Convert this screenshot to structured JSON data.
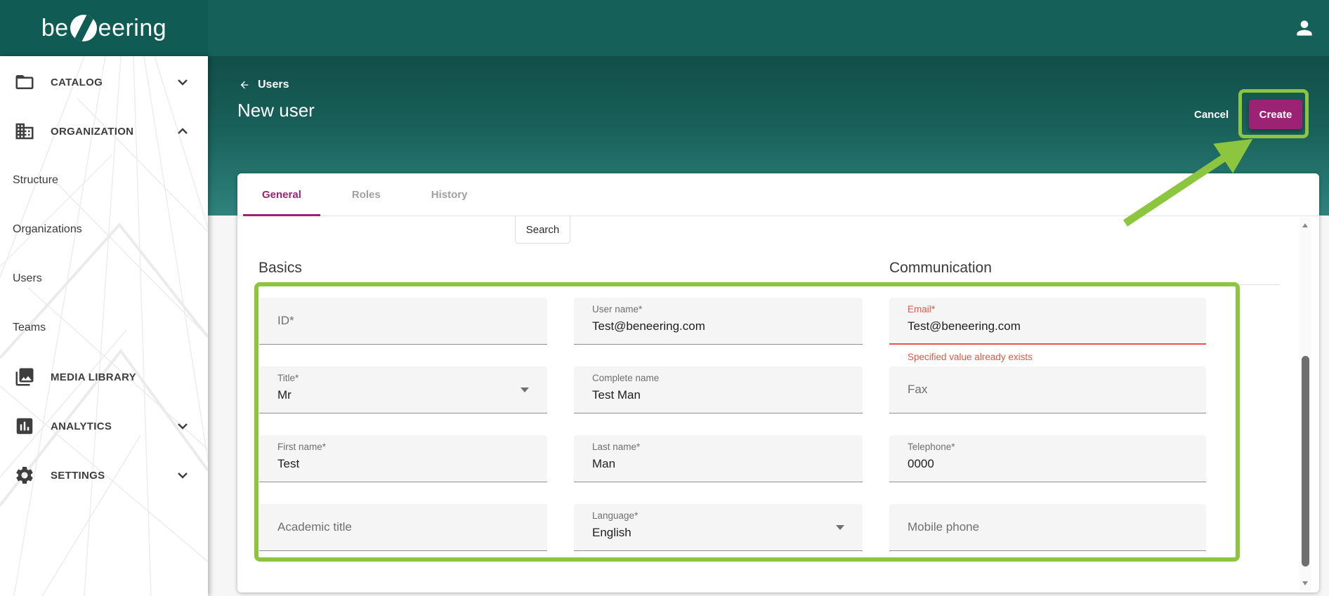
{
  "colors": {
    "topbar_teal": "#156058",
    "logo_block_teal": "#115B55",
    "header_gradient_top": "#114E49",
    "header_gradient_bottom": "#2F837D",
    "accent_magenta": "#9C2373",
    "annotation_green": "#8CC63E",
    "error_red": "#E8544A"
  },
  "brand": {
    "prefix": "be",
    "suffix": "eering"
  },
  "sidebar": {
    "items": [
      {
        "label": "CATALOG",
        "icon": "folder-icon",
        "chevron": "down"
      },
      {
        "label": "ORGANIZATION",
        "icon": "building-icon",
        "chevron": "up",
        "children": [
          {
            "label": "Structure"
          },
          {
            "label": "Organizations"
          },
          {
            "label": "Users"
          },
          {
            "label": "Teams"
          }
        ]
      },
      {
        "label": "MEDIA LIBRARY",
        "icon": "media-library-icon",
        "chevron": ""
      },
      {
        "label": "ANALYTICS",
        "icon": "analytics-icon",
        "chevron": "down"
      },
      {
        "label": "SETTINGS",
        "icon": "gear-icon",
        "chevron": "down"
      }
    ]
  },
  "header": {
    "back": "Users",
    "title": "New user",
    "cancel": "Cancel",
    "create": "Create"
  },
  "tabs": [
    {
      "label": "General",
      "active": true
    },
    {
      "label": "Roles",
      "active": false
    },
    {
      "label": "History",
      "active": false
    }
  ],
  "toolbar": {
    "search": "Search"
  },
  "form": {
    "basics_title": "Basics",
    "communication_title": "Communication",
    "id": {
      "placeholder": "ID*"
    },
    "user_name": {
      "label": "User name*",
      "value": "Test@beneering.com"
    },
    "email": {
      "label": "Email*",
      "value": "Test@beneering.com",
      "error": "Specified value already exists"
    },
    "title": {
      "label": "Title*",
      "value": "Mr"
    },
    "complete_name": {
      "label": "Complete name",
      "value": "Test Man"
    },
    "fax": {
      "placeholder": "Fax"
    },
    "first_name": {
      "label": "First name*",
      "value": "Test"
    },
    "last_name": {
      "label": "Last name*",
      "value": "Man"
    },
    "telephone": {
      "label": "Telephone*",
      "value": "0000"
    },
    "academic_title": {
      "placeholder": "Academic title"
    },
    "language": {
      "label": "Language*",
      "value": "English"
    },
    "mobile_phone": {
      "placeholder": "Mobile phone"
    }
  }
}
